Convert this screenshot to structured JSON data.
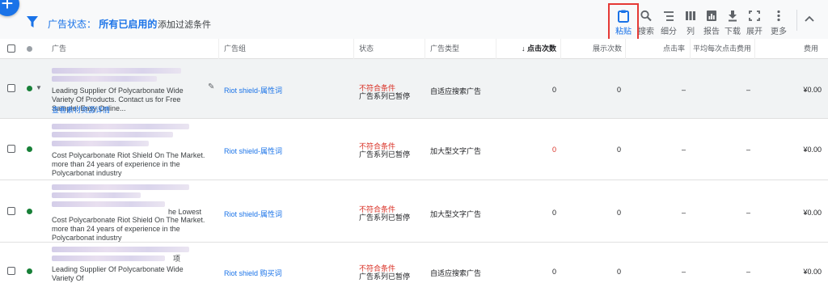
{
  "toolbar": {
    "add_button": "+",
    "filter_label": "广告状态：",
    "filter_value": "所有已启用的",
    "add_filter": "添加过滤条件",
    "tools": [
      {
        "icon": "clipboard-icon",
        "label": "粘贴",
        "active": true
      },
      {
        "icon": "search-icon",
        "label": "搜索"
      },
      {
        "icon": "segment-icon",
        "label": "细分"
      },
      {
        "icon": "columns-icon",
        "label": "列"
      },
      {
        "icon": "report-icon",
        "label": "报告"
      },
      {
        "icon": "download-icon",
        "label": "下载"
      },
      {
        "icon": "expand-icon",
        "label": "展开"
      },
      {
        "icon": "more-icon",
        "label": "更多"
      }
    ]
  },
  "table": {
    "headers": {
      "ad": "广告",
      "ad_group": "广告组",
      "status": "状态",
      "ad_type": "广告类型",
      "clicks": "点击次数",
      "impressions": "展示次数",
      "ctr": "点击率",
      "avg_cpc": "平均每次点击费用",
      "cost": "费用"
    },
    "rows": [
      {
        "text": "Leading Supplier Of Polycarbonate Wide Variety Of Products. Contact us for Free Sample! Easy Online...",
        "link": "查看素材资源详情",
        "group": "Riot shield-属性词",
        "status_warn": "不符合条件",
        "status_note": "广告系列已暂停",
        "type": "自适应搜索广告",
        "clicks": "0",
        "impressions": "0",
        "ctr": "–",
        "avg_cpc": "–",
        "cost": "¥0.00"
      },
      {
        "text": "Cost Polycarbonate Riot Shield On The Market. more than 24 years of experience in the Polycarbonat industry",
        "group": "Riot shield-属性词",
        "status_warn": "不符合条件",
        "status_note": "广告系列已暂停",
        "type": "加大型文字广告",
        "clicks": "0",
        "impressions": "0",
        "ctr": "–",
        "avg_cpc": "–",
        "cost": "¥0.00"
      },
      {
        "text_a": "he Lowest",
        "text_b": "Cost Polycarbonate Riot Shield On The Market. more than 24 years of experience in the Polycarbonat industry",
        "group": "Riot shield-属性词",
        "status_warn": "不符合条件",
        "status_note": "广告系列已暂停",
        "type": "加大型文字广告",
        "clicks": "0",
        "impressions": "0",
        "ctr": "–",
        "avg_cpc": "–",
        "cost": "¥0.00"
      },
      {
        "text_a": "项",
        "text": "Leading Supplier Of Polycarbonate Wide Variety Of",
        "group": "Riot shield 购买词",
        "status_warn": "不符合条件",
        "status_note": "广告系列已暂停",
        "type": "自适应搜索广告",
        "clicks": "0",
        "impressions": "0",
        "ctr": "–",
        "avg_cpc": "–",
        "cost": "¥0.00"
      }
    ]
  },
  "colors": {
    "accent": "#1a73e8",
    "warning": "#d93025",
    "enabled": "#188038",
    "highlight": "#e53935"
  }
}
